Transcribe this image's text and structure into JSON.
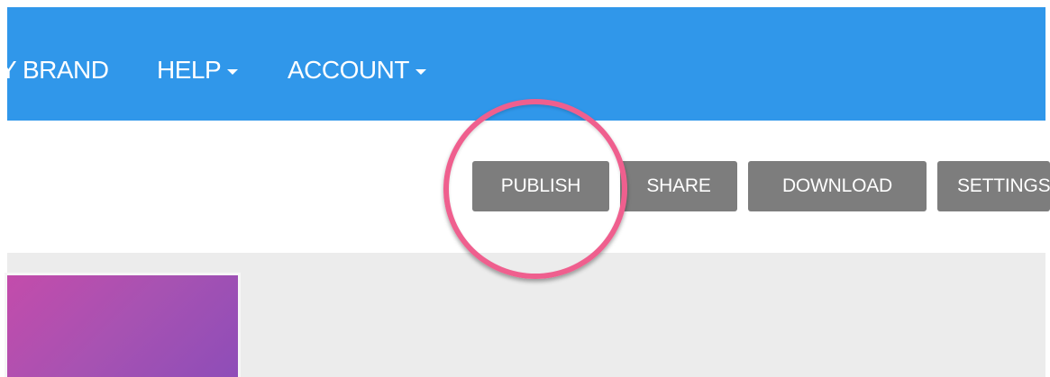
{
  "navbar": {
    "items": [
      {
        "label": "Y BRAND",
        "has_dropdown": false
      },
      {
        "label": "HELP",
        "has_dropdown": true
      },
      {
        "label": "ACCOUNT",
        "has_dropdown": true
      }
    ],
    "background": "#3097ea"
  },
  "toolbar": {
    "publish_label": "PUBLISH",
    "share_label": "SHARE",
    "download_label": "DOWNLOAD",
    "settings_label": "SETTINGS",
    "button_color": "#7d7d7d"
  },
  "annotation": {
    "highlight_color": "#ef5f8e",
    "highlighted_target": "publish-button"
  },
  "content": {
    "thumbnail_gradient": [
      "#c34cab",
      "#8e4db8"
    ],
    "area_background": "#ececec"
  }
}
